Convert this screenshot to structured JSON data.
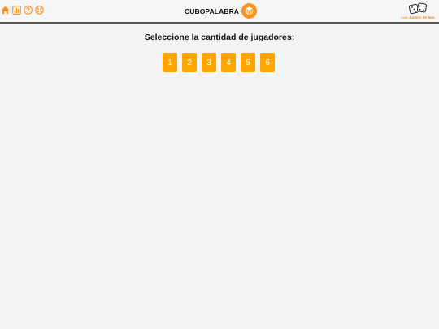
{
  "header": {
    "title": "CUBOPALABRA",
    "brand": "Los Juegos De Mat",
    "icons": [
      "home-icon",
      "stats-icon",
      "help-icon",
      "fullscreen-icon"
    ],
    "logo_icon": "cube-logo-icon"
  },
  "main": {
    "prompt": "Seleccione la cantidad de jugadores:",
    "player_options": [
      "1",
      "2",
      "3",
      "4",
      "5",
      "6"
    ]
  },
  "colors": {
    "accent": "#ffa500",
    "brand_orange": "#f7931e",
    "background": "#f4f4f4",
    "divider": "#555555"
  }
}
